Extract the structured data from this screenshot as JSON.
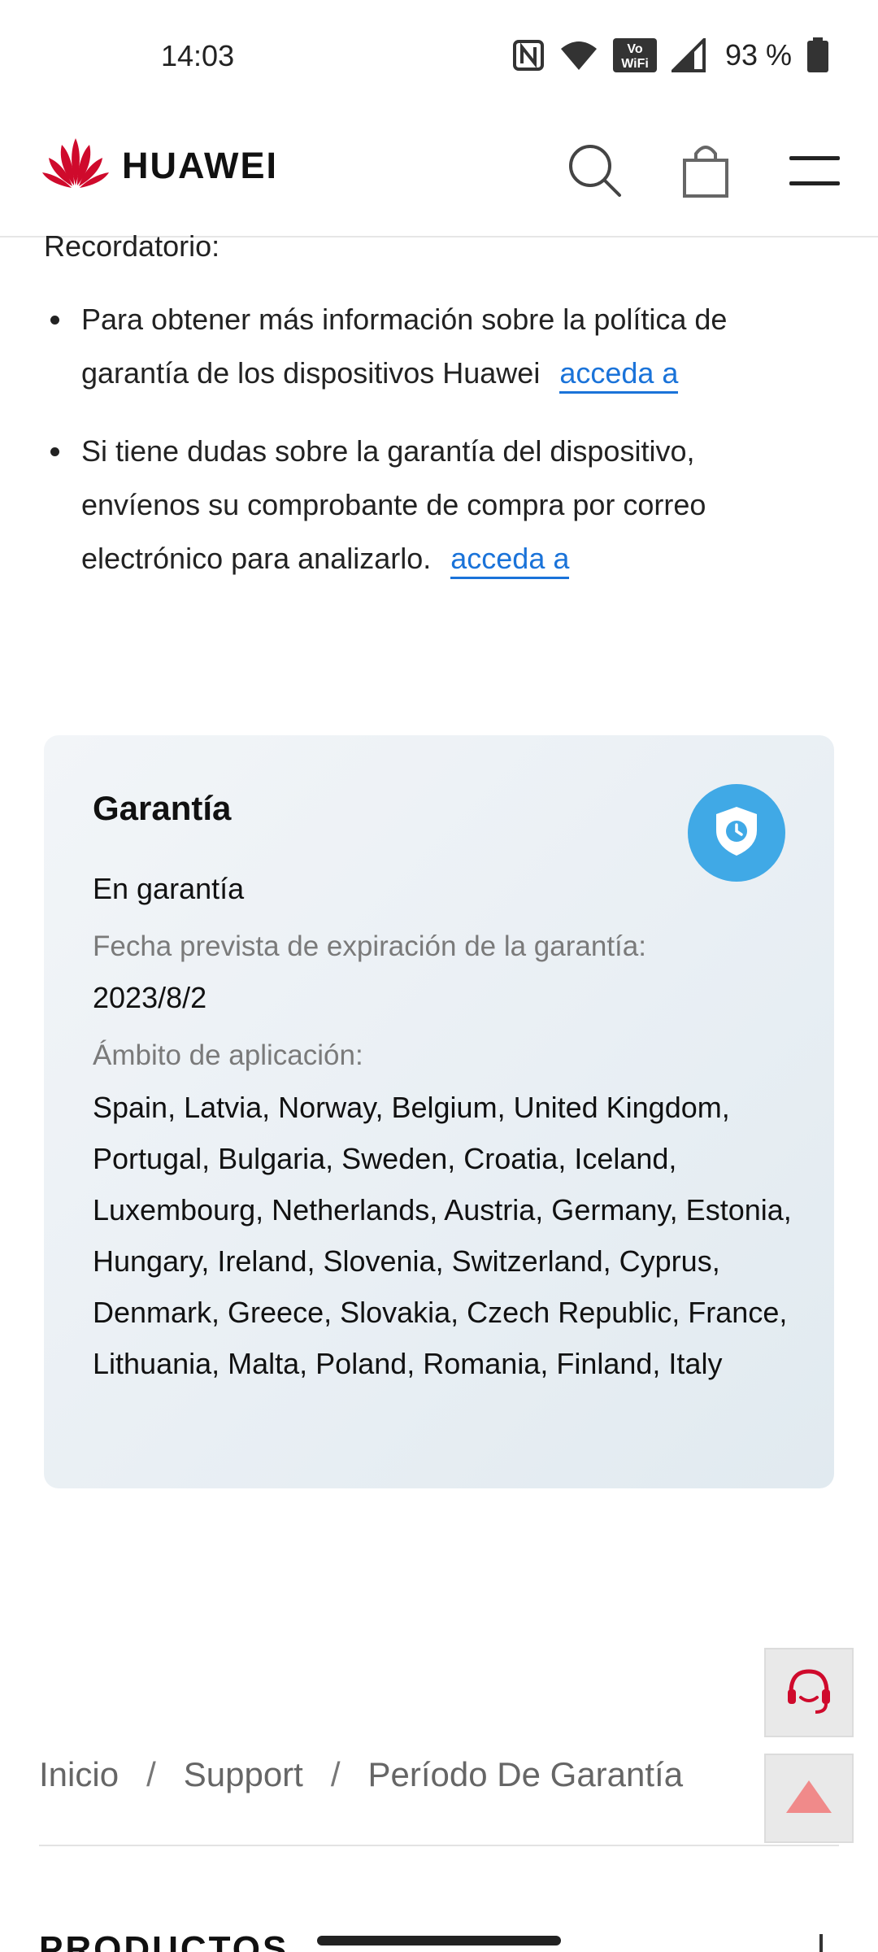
{
  "status_bar": {
    "time": "14:03",
    "battery_text": "93 %",
    "icons": [
      "nfc-icon",
      "wifi-icon",
      "vowifi-icon",
      "signal-icon",
      "battery-icon"
    ],
    "vowifi_top": "Vo",
    "vowifi_bottom": "WiFi"
  },
  "header": {
    "brand": "HUAWEI",
    "brand_color": "#cf0a2c"
  },
  "content": {
    "reminder_title": "Recordatorio:",
    "bullets": [
      {
        "text": "Para obtener más información sobre la política de garantía de los dispositivos Huawei",
        "link": "acceda a"
      },
      {
        "text": "Si tiene dudas sobre la garantía del dispositivo, envíenos su comprobante de compra por correo electrónico para analizarlo.",
        "link": "acceda a"
      }
    ]
  },
  "warranty_card": {
    "title": "Garantía",
    "status": "En garantía",
    "expiry_label": "Fecha prevista de expiración de la garantía:",
    "expiry_date": "2023/8/2",
    "scope_label": "Ámbito de aplicación:",
    "countries": "Spain, Latvia, Norway, Belgium, United Kingdom, Portugal, Bulgaria, Sweden, Croatia, Iceland, Luxembourg, Netherlands, Austria, Germany, Estonia, Hungary, Ireland, Slovenia, Switzerland, Cyprus, Denmark, Greece, Slovakia, Czech Republic, France, Lithuania, Malta, Poland, Romania, Finland, Italy",
    "badge_color": "#40a9e6"
  },
  "breadcrumb": {
    "items": [
      "Inicio",
      "Support",
      "Período De Garantía"
    ],
    "separator": "/"
  },
  "footer": {
    "heading": "PRODUCTOS"
  }
}
